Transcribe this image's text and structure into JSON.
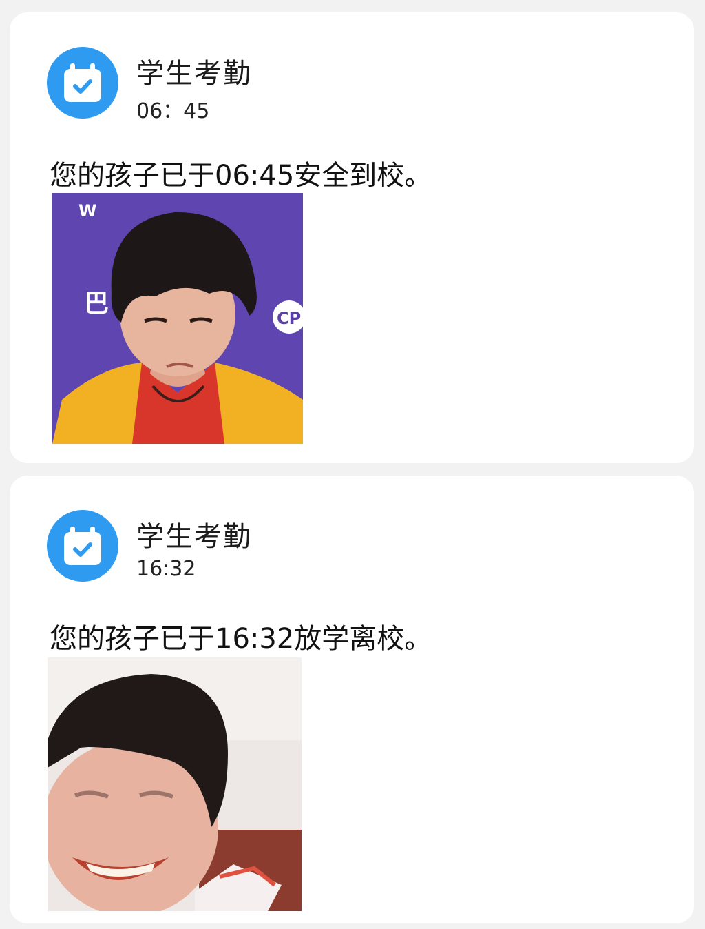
{
  "notifications": [
    {
      "app_name": "学生考勤",
      "time": "06：45",
      "message": "您的孩子已于06:45安全到校。",
      "icon": "calendar-check-icon",
      "accent_color": "#2f9bf0",
      "photo_overlay_text": [
        "W",
        "巴",
        "CP"
      ]
    },
    {
      "app_name": "学生考勤",
      "time": "16:32",
      "message": "您的孩子已于16:32放学离校。",
      "icon": "calendar-check-icon",
      "accent_color": "#2f9bf0"
    }
  ]
}
